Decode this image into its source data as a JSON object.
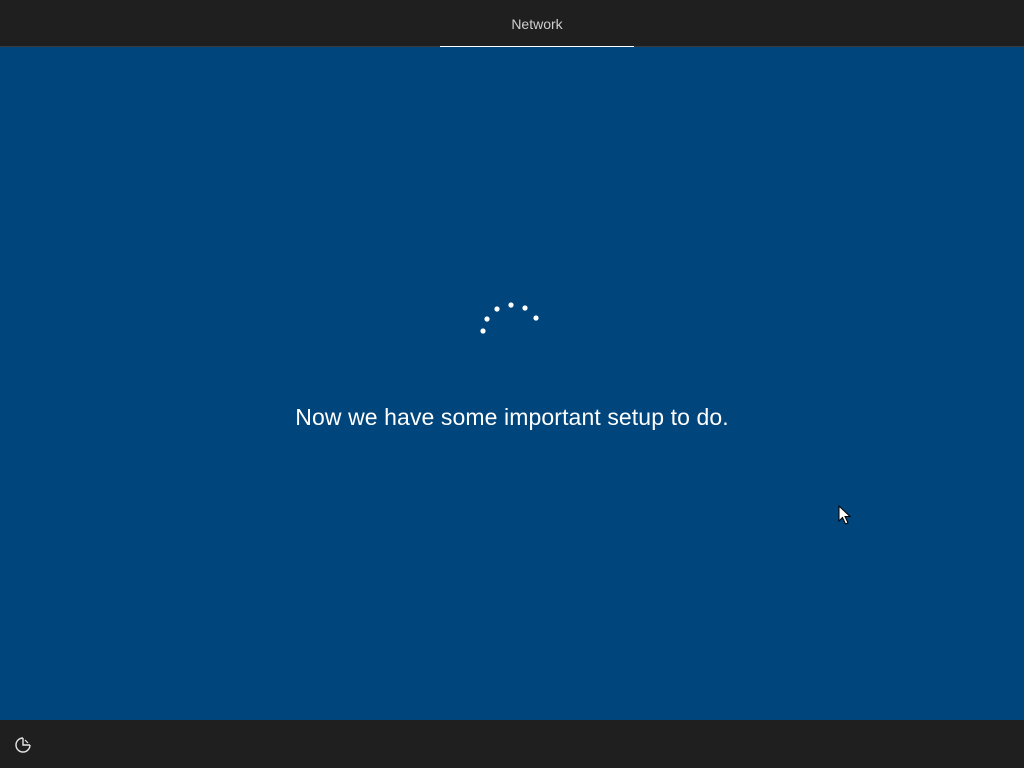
{
  "header": {
    "tabs": [
      {
        "label": "Network",
        "active": true
      }
    ]
  },
  "main": {
    "message": "Now we have some important setup to do.",
    "background_color": "#00457b",
    "spinner_icon": "loading-dots-icon"
  },
  "footer": {
    "ease_of_access_icon": "ease-of-access-icon"
  },
  "colors": {
    "bar": "#1f1f1f",
    "accent": "#ffffff",
    "text": "#ffffff"
  }
}
